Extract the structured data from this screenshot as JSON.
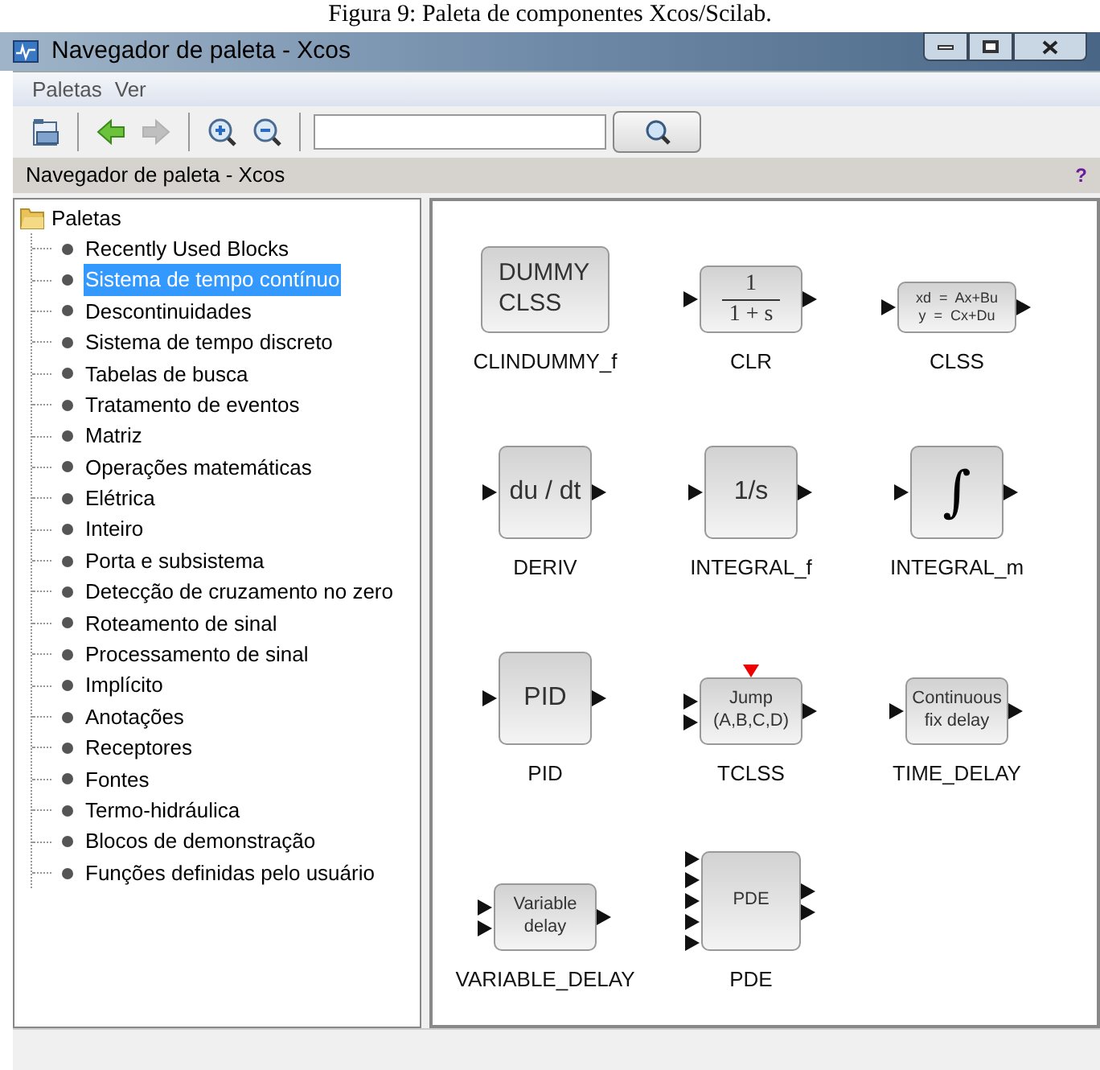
{
  "caption": "Figura 9: Paleta de componentes Xcos/Scilab.",
  "window": {
    "title": "Navegador de paleta - Xcos"
  },
  "menu": [
    "Paletas",
    "Ver"
  ],
  "toolbar": [
    {
      "kind": "palette",
      "disabled": false
    },
    {
      "kind": "back",
      "disabled": false
    },
    {
      "kind": "forward",
      "disabled": true
    },
    {
      "kind": "zoom_in",
      "disabled": false
    },
    {
      "kind": "zoom_out",
      "disabled": false
    }
  ],
  "panel_header": {
    "title": "Navegador de paleta - Xcos",
    "help": "?"
  },
  "tree": {
    "label": "Paletas",
    "expanded": true,
    "children": [
      {
        "label": "Recently Used Blocks",
        "selected": false
      },
      {
        "label": "Sistema de tempo contínuo",
        "selected": true
      },
      {
        "label": "Descontinuidades",
        "selected": false
      },
      {
        "label": "Sistema de tempo discreto",
        "selected": false
      },
      {
        "label": "Tabelas de busca",
        "selected": false
      },
      {
        "label": "Tratamento de eventos",
        "selected": false
      },
      {
        "label": "Matriz",
        "selected": false
      },
      {
        "label": "Operações matemáticas",
        "selected": false
      },
      {
        "label": "Elétrica",
        "selected": false
      },
      {
        "label": "Inteiro",
        "selected": false
      },
      {
        "label": "Porta e subsistema",
        "selected": false
      },
      {
        "label": "Detecção de cruzamento no zero",
        "selected": false
      },
      {
        "label": "Roteamento de sinal",
        "selected": false
      },
      {
        "label": "Processamento de sinal",
        "selected": false
      },
      {
        "label": "Implícito",
        "selected": false
      },
      {
        "label": "Anotações",
        "selected": false
      },
      {
        "label": "Receptores",
        "selected": false
      },
      {
        "label": "Fontes",
        "selected": false
      },
      {
        "label": "Termo-hidráulica",
        "selected": false
      },
      {
        "label": "Blocos de demonstração",
        "selected": false
      },
      {
        "label": "Funções definidas pelo usuário",
        "selected": false
      }
    ]
  },
  "blocks": [
    {
      "name": "CLINDUMMY_f",
      "kind": "dummy",
      "lines": [
        "DUMMY",
        "CLSS"
      ],
      "event_input": false
    },
    {
      "name": "CLR",
      "kind": "fraction",
      "numerator": "1",
      "denominator": "1 + s",
      "in_ports": [
        {
          "kind": "data"
        }
      ],
      "out_ports": [
        {
          "kind": "data"
        }
      ],
      "event_input": false
    },
    {
      "name": "CLSS",
      "kind": "equations",
      "lines": [
        "xd  =  Ax+Bu",
        "y  =  Cx+Du"
      ],
      "in_ports": [
        {
          "kind": "data"
        }
      ],
      "out_ports": [
        {
          "kind": "data"
        }
      ],
      "event_input": false
    },
    {
      "name": "DERIV",
      "kind": "text",
      "lines": [
        "du / dt"
      ],
      "in_ports": [
        {
          "kind": "data"
        }
      ],
      "out_ports": [
        {
          "kind": "data"
        }
      ],
      "event_input": false
    },
    {
      "name": "INTEGRAL_f",
      "kind": "text",
      "lines": [
        "1/s"
      ],
      "in_ports": [
        {
          "kind": "data"
        }
      ],
      "out_ports": [
        {
          "kind": "data"
        }
      ],
      "event_input": false
    },
    {
      "name": "INTEGRAL_m",
      "kind": "symbol",
      "symbol": "∫",
      "in_ports": [
        {
          "kind": "data"
        }
      ],
      "out_ports": [
        {
          "kind": "data"
        }
      ],
      "event_input": false
    },
    {
      "name": "PID",
      "kind": "text",
      "lines": [
        "PID"
      ],
      "in_ports": [
        {
          "kind": "data"
        }
      ],
      "out_ports": [
        {
          "kind": "data"
        }
      ],
      "event_input": false
    },
    {
      "name": "TCLSS",
      "kind": "small_text",
      "lines": [
        "Jump",
        "(A,B,C,D)"
      ],
      "in_ports": [
        {
          "kind": "data"
        },
        {
          "kind": "data"
        }
      ],
      "out_ports": [
        {
          "kind": "data"
        }
      ],
      "event_input": true
    },
    {
      "name": "TIME_DELAY",
      "kind": "small_text",
      "lines": [
        "Continuous",
        "fix delay"
      ],
      "in_ports": [
        {
          "kind": "data"
        }
      ],
      "out_ports": [
        {
          "kind": "data"
        }
      ],
      "event_input": false
    },
    {
      "name": "VARIABLE_DELAY",
      "kind": "small_text",
      "lines": [
        "Variable",
        "delay"
      ],
      "in_ports": [
        {
          "kind": "data"
        },
        {
          "kind": "data"
        }
      ],
      "out_ports": [
        {
          "kind": "data"
        }
      ],
      "event_input": false
    },
    {
      "name": "PDE",
      "kind": "multiport",
      "lines": [
        "PDE"
      ],
      "in_ports": [
        {
          "kind": "data"
        },
        {
          "kind": "data"
        },
        {
          "kind": "data"
        },
        {
          "kind": "data"
        },
        {
          "kind": "data"
        }
      ],
      "out_ports": [
        {
          "kind": "data"
        },
        {
          "kind": "data"
        }
      ],
      "event_input": false
    }
  ]
}
